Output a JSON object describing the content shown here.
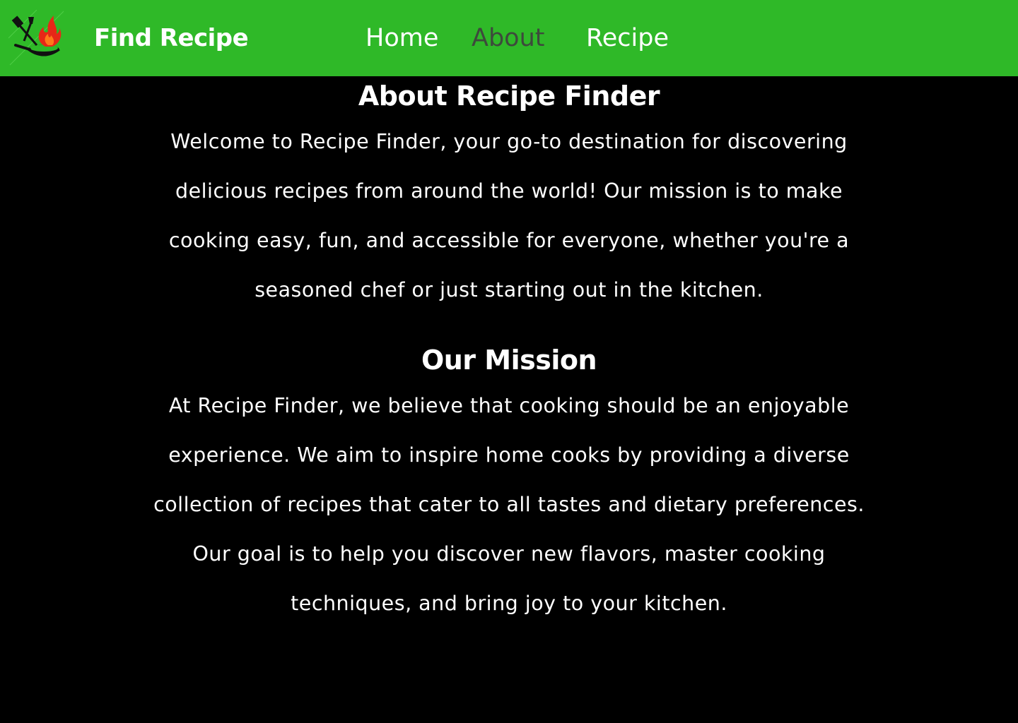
{
  "header": {
    "brand": "Find Recipe",
    "nav": {
      "home": "Home",
      "about": "About",
      "recipe": "Recipe"
    },
    "active_tab": "about",
    "colors": {
      "background": "#2fb928",
      "link": "#ffffff",
      "active_link": "#3d4a3c"
    }
  },
  "about": {
    "title": "About Recipe Finder",
    "text": "Welcome to Recipe Finder, your go-to destination for discovering delicious recipes from around the world! Our mission is to make cooking easy, fun, and accessible for everyone, whether you're a seasoned chef or just starting out in the kitchen."
  },
  "mission": {
    "title": "Our Mission",
    "text": "At Recipe Finder, we believe that cooking should be an enjoyable experience. We aim to inspire home cooks by providing a diverse collection of recipes that cater to all tastes and dietary preferences. Our goal is to help you discover new flavors, master cooking techniques, and bring joy to your kitchen."
  },
  "page": {
    "background": "#000000",
    "text_color": "#ffffff"
  }
}
